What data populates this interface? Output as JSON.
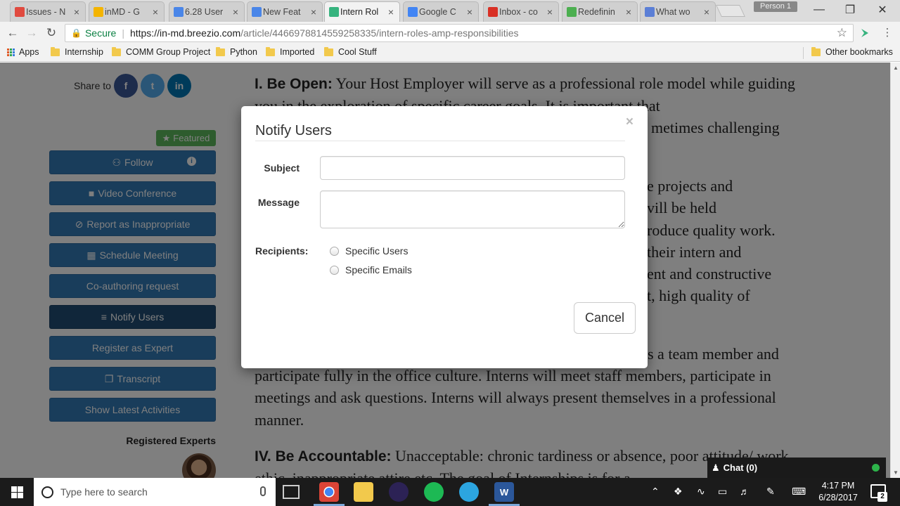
{
  "browser": {
    "tabs": [
      {
        "title": "Issues - N",
        "favicon_color": "#e04a3f"
      },
      {
        "title": "inMD - G",
        "favicon_color": "#f4b400"
      },
      {
        "title": "6.28 User",
        "favicon_color": "#4a86e8"
      },
      {
        "title": "New Feat",
        "favicon_color": "#4a86e8"
      },
      {
        "title": "Intern Rol",
        "favicon_color": "#36b37e"
      },
      {
        "title": "Google C",
        "favicon_color": "#4285f4"
      },
      {
        "title": "Inbox - co",
        "favicon_color": "#d93025"
      },
      {
        "title": "Redefinin",
        "favicon_color": "#4caf50"
      },
      {
        "title": "What wo",
        "favicon_color": "#5b7fd6"
      }
    ],
    "profile": "Person 1",
    "url": {
      "secure_label": "Secure",
      "host": "https://in-md.breezio.com",
      "path": "/article/4466978814559258335/intern-roles-amp-responsibilities"
    },
    "bookmarks": [
      "Apps",
      "Internship",
      "COMM Group Project",
      "Python",
      "Imported",
      "Cool Stuff"
    ],
    "other_bookmarks": "Other bookmarks"
  },
  "sidebar": {
    "share_label": "Share to",
    "share_buttons": [
      {
        "icon": "facebook-icon",
        "glyph": "f",
        "color": "#3b5998"
      },
      {
        "icon": "twitter-icon",
        "glyph": "t",
        "color": "#55acee"
      },
      {
        "icon": "linkedin-icon",
        "glyph": "in",
        "color": "#0077b5"
      }
    ],
    "featured_badge": "Featured",
    "buttons": [
      {
        "label": "Follow",
        "icon": "users-icon",
        "glyph": "⚇"
      },
      {
        "label": "Video Conference",
        "icon": "video-icon",
        "glyph": "■"
      },
      {
        "label": "Report as Inappropriate",
        "icon": "ban-icon",
        "glyph": "⊘"
      },
      {
        "label": "Schedule Meeting",
        "icon": "calendar-icon",
        "glyph": "▦"
      },
      {
        "label": "Co-authoring request",
        "icon": "",
        "glyph": ""
      },
      {
        "label": "Notify Users",
        "icon": "rss-icon",
        "glyph": "≡"
      },
      {
        "label": "Register as Expert",
        "icon": "",
        "glyph": ""
      },
      {
        "label": "Transcript",
        "icon": "copy-icon",
        "glyph": "❐"
      },
      {
        "label": "Show Latest Activities",
        "icon": "",
        "glyph": ""
      }
    ],
    "registered_experts": "Registered Experts"
  },
  "article": {
    "p1_heading": "I. Be Open:",
    "p1_text": "Your Host Employer will serve as a professional role model while guiding you in the exploration of specific career goals. It is important that",
    "p1_tail": "metimes challenging",
    "p2_fragments": [
      "e projects and",
      "vill be held",
      "roduce quality work.",
      "their intern and",
      "ent and constructive",
      "t, high quality of"
    ],
    "p3_start": "s a team member and",
    "p3_rest": "participate fully in the office culture. Interns will meet staff members, participate in meetings and ask questions. Interns will always present themselves in a professional manner.",
    "p4_heading": "IV. Be Accountable:",
    "p4_text": "Unacceptable: chronic tardiness or absence, poor attitude/ work ethic, inappropriate attire etc. The goal of Internships is for a"
  },
  "chat": {
    "label": "Chat (0)",
    "status_color": "#2db34a"
  },
  "modal": {
    "title": "Notify Users",
    "subject_label": "Subject",
    "subject_value": "",
    "message_label": "Message",
    "message_value": "",
    "recipients_label": "Recipients:",
    "options": [
      "Specific Users",
      "Specific Emails"
    ],
    "cancel_label": "Cancel"
  },
  "taskbar": {
    "search_placeholder": "Type here to search",
    "time": "4:17 PM",
    "date": "6/28/2017",
    "notification_count": "2"
  }
}
